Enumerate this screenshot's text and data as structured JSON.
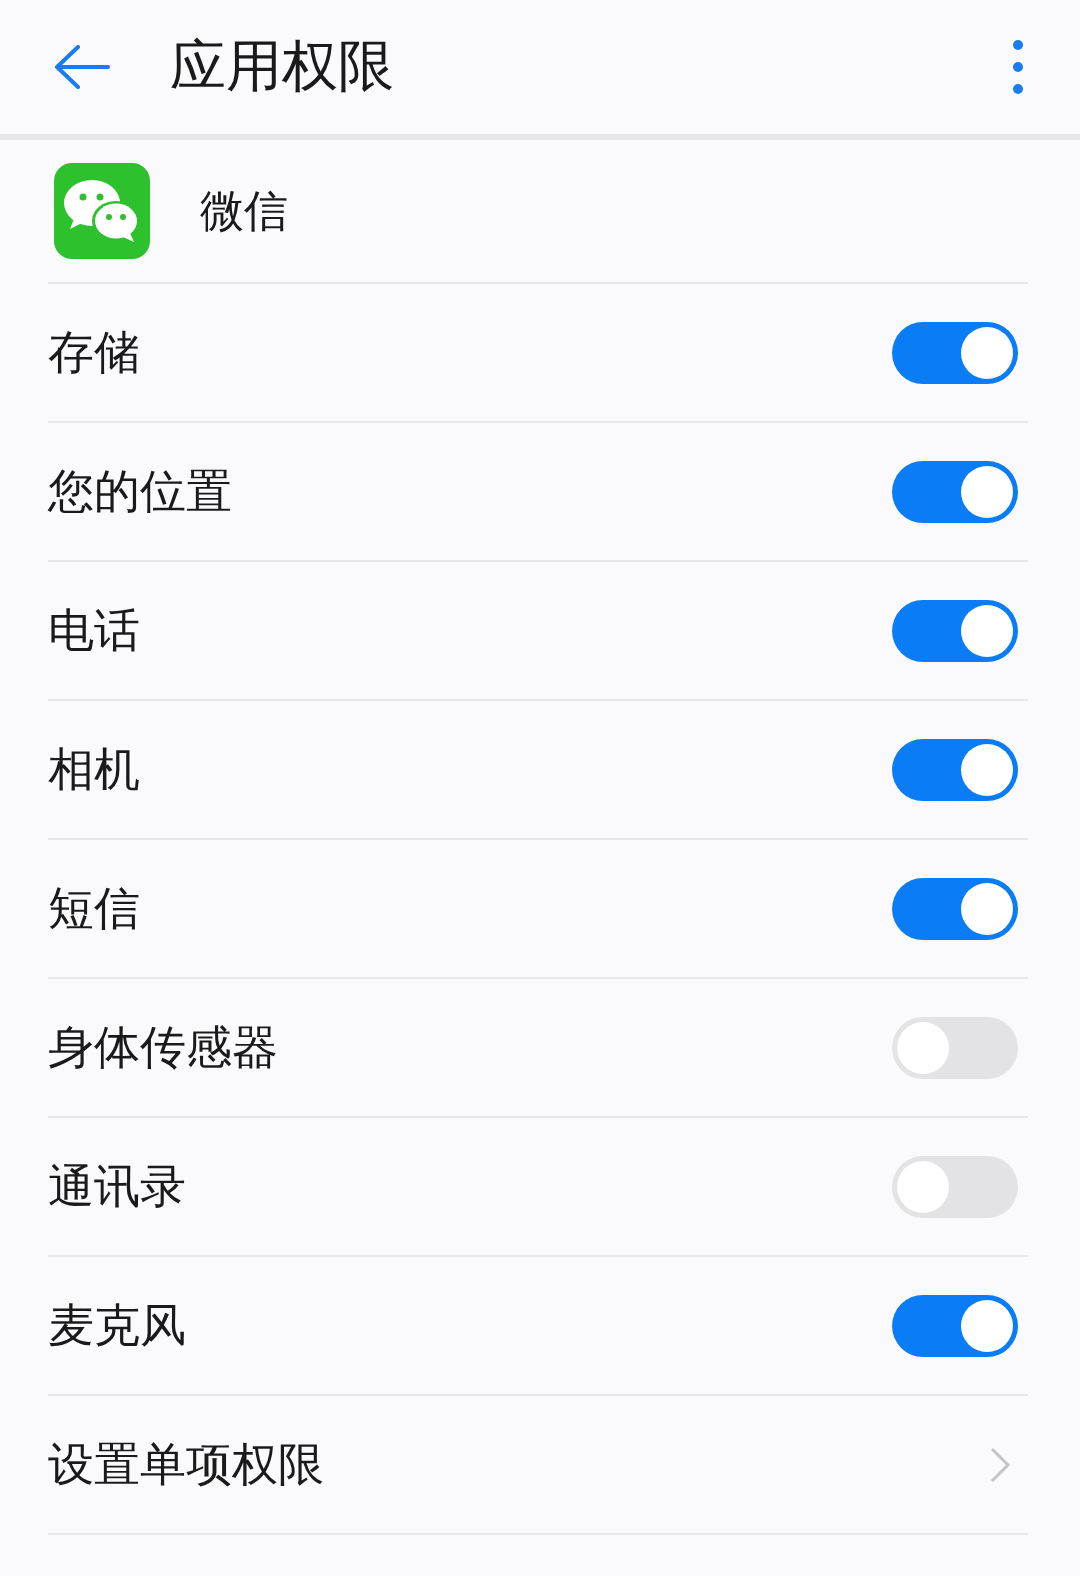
{
  "header": {
    "title": "应用权限"
  },
  "app": {
    "name": "微信"
  },
  "permissions": [
    {
      "kind": "toggle",
      "label": "存储",
      "on": true
    },
    {
      "kind": "toggle",
      "label": "您的位置",
      "on": true
    },
    {
      "kind": "toggle",
      "label": "电话",
      "on": true
    },
    {
      "kind": "toggle",
      "label": "相机",
      "on": true
    },
    {
      "kind": "toggle",
      "label": "短信",
      "on": true
    },
    {
      "kind": "toggle",
      "label": "身体传感器",
      "on": false
    },
    {
      "kind": "toggle",
      "label": "通讯录",
      "on": false
    },
    {
      "kind": "toggle",
      "label": "麦克风",
      "on": true
    },
    {
      "kind": "link",
      "label": "设置单项权限"
    }
  ]
}
